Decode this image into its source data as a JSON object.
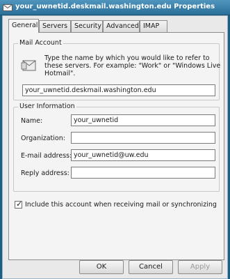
{
  "window": {
    "title": "your_uwnetid.deskmail.washington.edu Properties"
  },
  "tabs": [
    {
      "label": "General",
      "active": true
    },
    {
      "label": "Servers"
    },
    {
      "label": "Security"
    },
    {
      "label": "Advanced"
    },
    {
      "label": "IMAP"
    }
  ],
  "mail_account": {
    "group_title": "Mail Account",
    "description": "Type the name by which you would like to refer to these servers.  For example: \"Work\" or \"Windows Live Hotmail\".",
    "account_name": "your_uwnetid.deskmail.washington.edu"
  },
  "user_info": {
    "group_title": "User Information",
    "fields": [
      {
        "label": "Name:",
        "value": "your_uwnetid"
      },
      {
        "label": "Organization:",
        "value": ""
      },
      {
        "label": "E-mail address:",
        "value": "your_uwnetid@uw.edu"
      },
      {
        "label": "Reply address:",
        "value": ""
      }
    ]
  },
  "include_account": {
    "label": "Include this account when receiving mail or synchronizing",
    "checked": true,
    "mark": "✓"
  },
  "buttons": {
    "ok": "OK",
    "cancel": "Cancel",
    "apply": "Apply"
  }
}
